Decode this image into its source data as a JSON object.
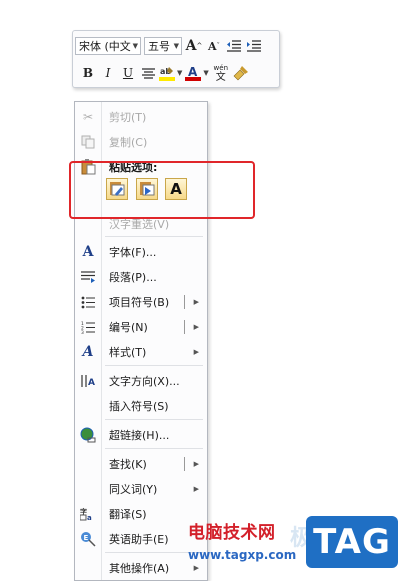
{
  "mini_toolbar": {
    "font_name": "宋体 (中文",
    "font_size": "五号",
    "grow_font": "A",
    "shrink_font": "A",
    "bold": "B",
    "italic": "I",
    "underline": "U",
    "font_color_letter": "A",
    "phonetic_top": "wén",
    "phonetic_bottom": "文"
  },
  "context_menu": {
    "cut": "剪切(T)",
    "copy": "复制(C)",
    "paste_options": "粘贴选项:",
    "paste_text_only": "A",
    "reconvert": "汉字重选(V)",
    "font": "字体(F)...",
    "paragraph": "段落(P)...",
    "bullets": "项目符号(B)",
    "numbering": "编号(N)",
    "styles": "样式(T)",
    "text_direction": "文字方向(X)...",
    "insert_symbol": "插入符号(S)",
    "hyperlink": "超链接(H)...",
    "find": "查找(K)",
    "synonyms": "同义词(Y)",
    "translate": "翻译(S)",
    "english_assistant": "英语助手(E)",
    "other_actions": "其他操作(A)"
  },
  "watermark": {
    "title": "电脑技术网",
    "url": "www.tagxp.com",
    "logo": "TAG"
  },
  "colors": {
    "highlight_border": "#e0262a",
    "highlighter_yellow": "#ffea00",
    "font_color_red": "#d00000"
  }
}
